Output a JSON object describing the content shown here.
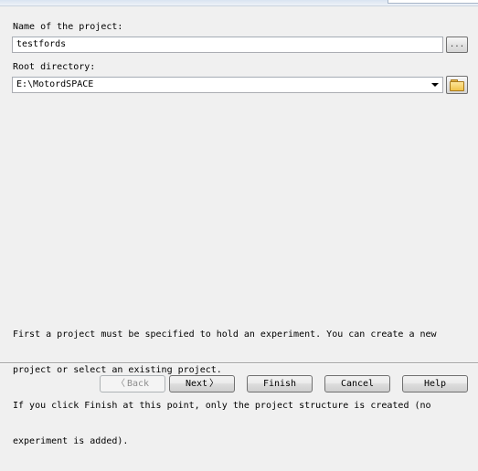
{
  "form": {
    "project_name_label": "Name of the project:",
    "project_name_value": "testfords",
    "project_browse_label": "...",
    "root_dir_label": "Root directory:",
    "root_dir_value": "E:\\MotordSPACE"
  },
  "info": {
    "lines": [
      "First a project must be specified to hold an experiment. You can create a new",
      "project or select an existing project.",
      "If you click Finish at this point, only the project structure is created (no",
      "experiment is added)."
    ]
  },
  "buttons": {
    "back": "Back",
    "next": "Next",
    "finish": "Finish",
    "cancel": "Cancel",
    "help": "Help"
  },
  "icons": {
    "back": "chevron-left-icon",
    "next": "chevron-right-icon",
    "folder": "folder-icon",
    "dropdown": "chevron-down-icon"
  }
}
